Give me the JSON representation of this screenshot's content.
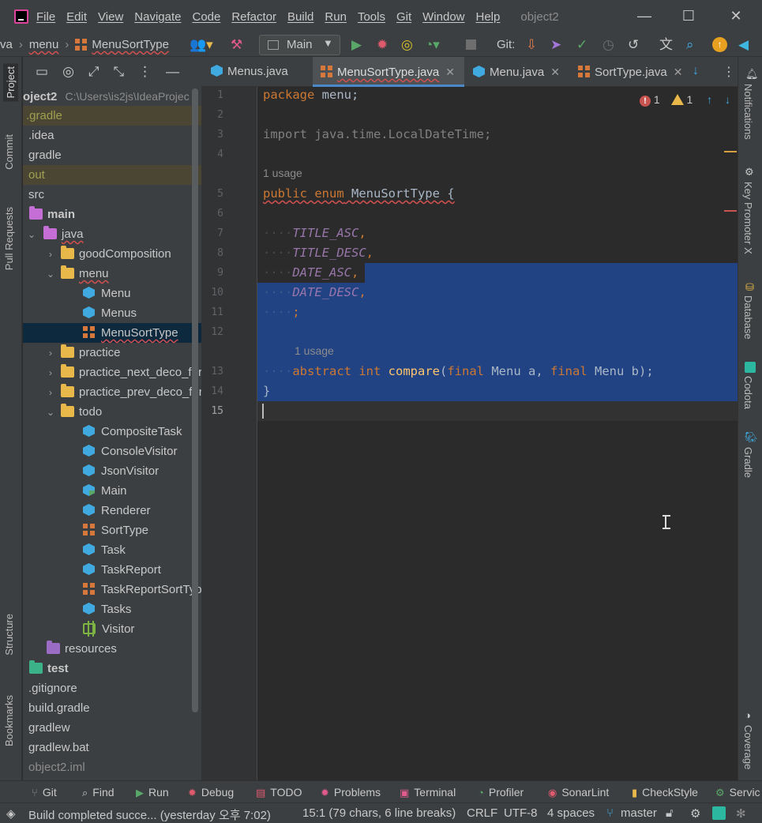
{
  "menubar": {
    "items": [
      "File",
      "Edit",
      "View",
      "Navigate",
      "Code",
      "Refactor",
      "Build",
      "Run",
      "Tools",
      "Git",
      "Window",
      "Help"
    ],
    "window_title": "object2",
    "minimize": "—",
    "maximize": "☐",
    "close": "✕"
  },
  "navbar": {
    "crumb_prefix": "va",
    "crumb_menu": "menu",
    "crumb_file": "MenuSortType",
    "run_config": "Main",
    "git_label": "Git:"
  },
  "left_strip": {
    "project": "Project",
    "commit": "Commit",
    "pull_requests": "Pull Requests",
    "structure": "Structure",
    "bookmarks": "Bookmarks"
  },
  "right_strip": {
    "notifications": "Notifications",
    "key_promoter": "Key Promoter X",
    "database": "Database",
    "codota": "Codota",
    "gradle": "Gradle",
    "coverage": "Coverage"
  },
  "project": {
    "root_name": "oject2",
    "root_path": "C:\\Users\\is2js\\IdeaProjec",
    "tree": [
      {
        "label": ".gradle"
      },
      {
        "label": ".idea"
      },
      {
        "label": "gradle"
      },
      {
        "label": "out"
      },
      {
        "label": "src"
      },
      {
        "label": "main"
      },
      {
        "label": "java"
      },
      {
        "label": "goodComposition"
      },
      {
        "label": "menu"
      },
      {
        "label": "Menu"
      },
      {
        "label": "Menus"
      },
      {
        "label": "MenuSortType"
      },
      {
        "label": "practice"
      },
      {
        "label": "practice_next_deco_for"
      },
      {
        "label": "practice_prev_deco_for"
      },
      {
        "label": "todo"
      },
      {
        "label": "CompositeTask"
      },
      {
        "label": "ConsoleVisitor"
      },
      {
        "label": "JsonVisitor"
      },
      {
        "label": "Main"
      },
      {
        "label": "Renderer"
      },
      {
        "label": "SortType"
      },
      {
        "label": "Task"
      },
      {
        "label": "TaskReport"
      },
      {
        "label": "TaskReportSortType"
      },
      {
        "label": "Tasks"
      },
      {
        "label": "Visitor"
      },
      {
        "label": "resources"
      },
      {
        "label": "test"
      },
      {
        "label": ".gitignore"
      },
      {
        "label": "build.gradle"
      },
      {
        "label": "gradlew"
      },
      {
        "label": "gradlew.bat"
      },
      {
        "label": "object2.iml"
      }
    ]
  },
  "tabs": [
    {
      "label": "Menus.java"
    },
    {
      "label": "MenuSortType.java"
    },
    {
      "label": "Menu.java"
    },
    {
      "label": "SortType.java"
    }
  ],
  "editor": {
    "line_numbers": [
      "1",
      "2",
      "3",
      "4",
      "5",
      "6",
      "7",
      "8",
      "9",
      "10",
      "11",
      "12",
      "13",
      "14",
      "15"
    ],
    "errors": "1",
    "warnings": "1",
    "usage_hint": "1 usage",
    "line1_kw": "package",
    "line1_rest": " menu;",
    "line3": "import java.time.LocalDateTime;",
    "line5_kw": "public enum",
    "line5_rest": " MenuSortType {",
    "enum_values": [
      "TITLE_ASC",
      "TITLE_DESC",
      "DATE_ASC",
      "DATE_DESC"
    ],
    "line13_kw1": "abstract int",
    "line13_fn": "compare",
    "line13_args": "(",
    "line13_final": "final",
    "line13_t1": " Menu a, ",
    "line13_t2": " Menu b);",
    "closing_brace": "}"
  },
  "tool_tabs": [
    "Git",
    "Find",
    "Run",
    "Debug",
    "TODO",
    "Problems",
    "Terminal",
    "Profiler",
    "SonarLint",
    "CheckStyle",
    "Servic"
  ],
  "status": {
    "message": "Build completed succe... (yesterday 오후 7:02)",
    "position": "15:1 (79 chars, 6 line breaks)",
    "line_sep": "CRLF",
    "encoding": "UTF-8",
    "indent": "4 spaces",
    "branch": "master"
  },
  "colors": {
    "selection": "#214283",
    "keyword": "#cc7832",
    "enum_constant": "#9876aa",
    "function": "#ffc66d",
    "active_tab_underline": "#4a88c7"
  }
}
